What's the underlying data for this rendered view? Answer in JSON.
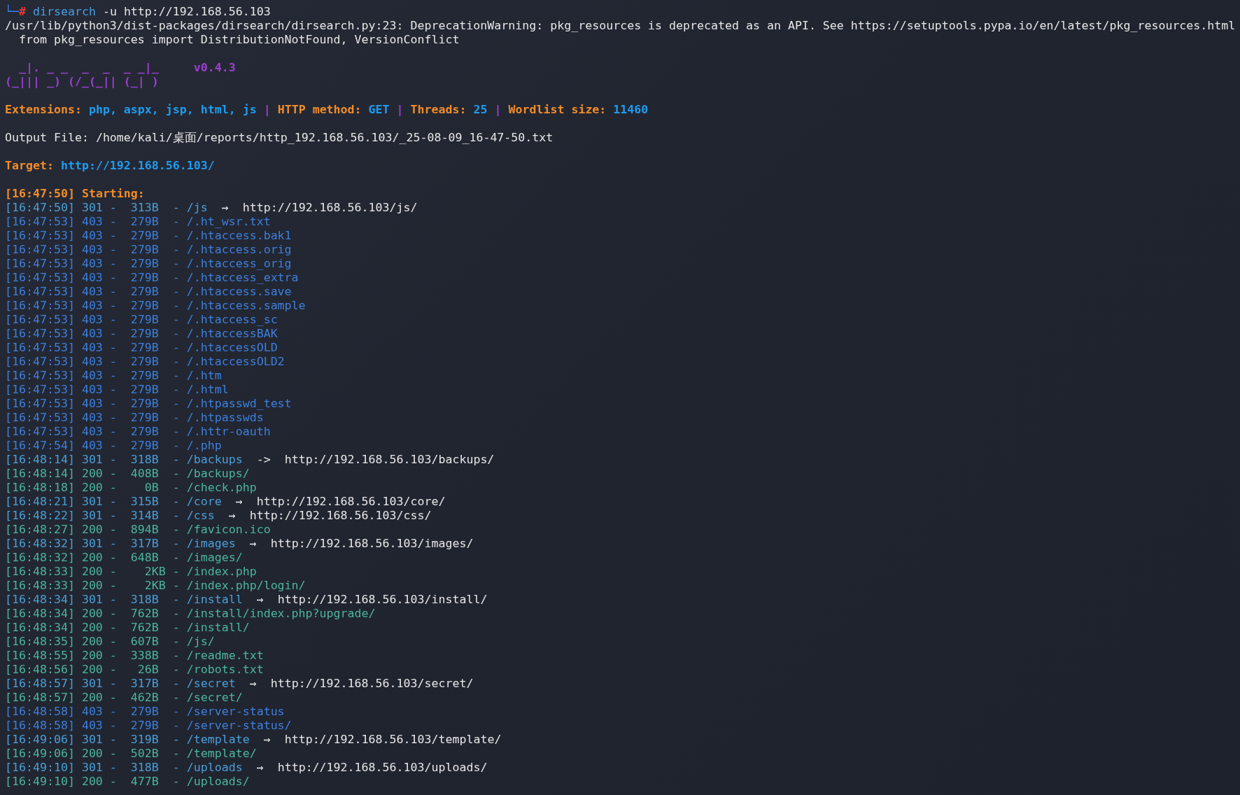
{
  "prompt": {
    "corner": "└─",
    "symbol": "#",
    "command": "dirsearch",
    "args": "-u http://192.168.56.103"
  },
  "warning_lines": [
    "/usr/lib/python3/dist-packages/dirsearch/dirsearch.py:23: DeprecationWarning: pkg_resources is deprecated as an API. See https://setuptools.pypa.io/en/latest/pkg_resources.html",
    "  from pkg_resources import DistributionNotFound, VersionConflict"
  ],
  "banner": {
    "art": [
      "  _|. _ _  _  _  _ _|_",
      "(_||| _) (/_(_|| (_| )"
    ],
    "version": "v0.4.3"
  },
  "config": [
    {
      "kind": "label",
      "text": "Extensions:"
    },
    {
      "kind": "value",
      "text": "php, aspx, jsp, html, js"
    },
    {
      "kind": "separator",
      "text": "|"
    },
    {
      "kind": "label",
      "text": "HTTP method:"
    },
    {
      "kind": "value",
      "text": "GET"
    },
    {
      "kind": "separator",
      "text": "|"
    },
    {
      "kind": "label",
      "text": "Threads:"
    },
    {
      "kind": "value",
      "text": "25"
    },
    {
      "kind": "separator",
      "text": "|"
    },
    {
      "kind": "label",
      "text": "Wordlist size:"
    },
    {
      "kind": "value",
      "text": "11460"
    }
  ],
  "output_file": {
    "label": "Output File:",
    "path": "/home/kali/桌面/reports/http_192.168.56.103/_25-08-09_16-47-50.txt"
  },
  "target": {
    "label": "Target:",
    "url": "http://192.168.56.103/"
  },
  "start": {
    "time": "[16:47:50]",
    "label": "Starting:"
  },
  "results": [
    {
      "line": "[16:47:50] 301 -  313B  - /js",
      "arrow": "→",
      "redirect": "http://192.168.56.103/js/",
      "color": "#4a9fd8"
    },
    {
      "line": "[16:47:53] 403 -  279B  - /.ht_wsr.txt",
      "color": "#3d7fdc"
    },
    {
      "line": "[16:47:53] 403 -  279B  - /.htaccess.bak1",
      "color": "#3d7fdc"
    },
    {
      "line": "[16:47:53] 403 -  279B  - /.htaccess.orig",
      "color": "#3d7fdc"
    },
    {
      "line": "[16:47:53] 403 -  279B  - /.htaccess_orig",
      "color": "#3d7fdc"
    },
    {
      "line": "[16:47:53] 403 -  279B  - /.htaccess_extra",
      "color": "#3d7fdc"
    },
    {
      "line": "[16:47:53] 403 -  279B  - /.htaccess.save",
      "color": "#3d7fdc"
    },
    {
      "line": "[16:47:53] 403 -  279B  - /.htaccess.sample",
      "color": "#3d7fdc"
    },
    {
      "line": "[16:47:53] 403 -  279B  - /.htaccess_sc",
      "color": "#3d7fdc"
    },
    {
      "line": "[16:47:53] 403 -  279B  - /.htaccessBAK",
      "color": "#3d7fdc"
    },
    {
      "line": "[16:47:53] 403 -  279B  - /.htaccessOLD",
      "color": "#3d7fdc"
    },
    {
      "line": "[16:47:53] 403 -  279B  - /.htaccessOLD2",
      "color": "#3d7fdc"
    },
    {
      "line": "[16:47:53] 403 -  279B  - /.htm",
      "color": "#3d7fdc"
    },
    {
      "line": "[16:47:53] 403 -  279B  - /.html",
      "color": "#3d7fdc"
    },
    {
      "line": "[16:47:53] 403 -  279B  - /.htpasswd_test",
      "color": "#3d7fdc"
    },
    {
      "line": "[16:47:53] 403 -  279B  - /.htpasswds",
      "color": "#3d7fdc"
    },
    {
      "line": "[16:47:53] 403 -  279B  - /.httr-oauth",
      "color": "#3d7fdc"
    },
    {
      "line": "[16:47:54] 403 -  279B  - /.php",
      "color": "#3d7fdc"
    },
    {
      "line": "[16:48:14] 301 -  318B  - /backups",
      "arrow": "->",
      "redirect": "http://192.168.56.103/backups/",
      "color": "#4a9fd8"
    },
    {
      "line": "[16:48:14] 200 -  408B  - /backups/",
      "color": "#4bb59e"
    },
    {
      "line": "[16:48:18] 200 -    0B  - /check.php",
      "color": "#4bb59e"
    },
    {
      "line": "[16:48:21] 301 -  315B  - /core",
      "arrow": "→",
      "redirect": "http://192.168.56.103/core/",
      "color": "#4a9fd8"
    },
    {
      "line": "[16:48:22] 301 -  314B  - /css",
      "arrow": "→",
      "redirect": "http://192.168.56.103/css/",
      "color": "#4a9fd8"
    },
    {
      "line": "[16:48:27] 200 -  894B  - /favicon.ico",
      "color": "#4bb59e"
    },
    {
      "line": "[16:48:32] 301 -  317B  - /images",
      "arrow": "→",
      "redirect": "http://192.168.56.103/images/",
      "color": "#4a9fd8"
    },
    {
      "line": "[16:48:32] 200 -  648B  - /images/",
      "color": "#4bb59e"
    },
    {
      "line": "[16:48:33] 200 -    2KB - /index.php",
      "color": "#4bb59e"
    },
    {
      "line": "[16:48:33] 200 -    2KB - /index.php/login/",
      "color": "#4bb59e"
    },
    {
      "line": "[16:48:34] 301 -  318B  - /install",
      "arrow": "→",
      "redirect": "http://192.168.56.103/install/",
      "color": "#4a9fd8"
    },
    {
      "line": "[16:48:34] 200 -  762B  - /install/index.php?upgrade/",
      "color": "#4bb59e"
    },
    {
      "line": "[16:48:34] 200 -  762B  - /install/",
      "color": "#4bb59e"
    },
    {
      "line": "[16:48:35] 200 -  607B  - /js/",
      "color": "#4bb59e"
    },
    {
      "line": "[16:48:55] 200 -  338B  - /readme.txt",
      "color": "#4bb59e"
    },
    {
      "line": "[16:48:56] 200 -   26B  - /robots.txt",
      "color": "#4bb59e"
    },
    {
      "line": "[16:48:57] 301 -  317B  - /secret",
      "arrow": "→",
      "redirect": "http://192.168.56.103/secret/",
      "color": "#4a9fd8"
    },
    {
      "line": "[16:48:57] 200 -  462B  - /secret/",
      "color": "#4bb59e"
    },
    {
      "line": "[16:48:58] 403 -  279B  - /server-status",
      "color": "#3d7fdc"
    },
    {
      "line": "[16:48:58] 403 -  279B  - /server-status/",
      "color": "#3d7fdc"
    },
    {
      "line": "[16:49:06] 301 -  319B  - /template",
      "arrow": "→",
      "redirect": "http://192.168.56.103/template/",
      "color": "#4a9fd8"
    },
    {
      "line": "[16:49:06] 200 -  502B  - /template/",
      "color": "#4bb59e"
    },
    {
      "line": "[16:49:10] 301 -  318B  - /uploads",
      "arrow": "→",
      "redirect": "http://192.168.56.103/uploads/",
      "color": "#4a9fd8"
    },
    {
      "line": "[16:49:10] 200 -  477B  - /uploads/",
      "color": "#4bb59e"
    }
  ]
}
